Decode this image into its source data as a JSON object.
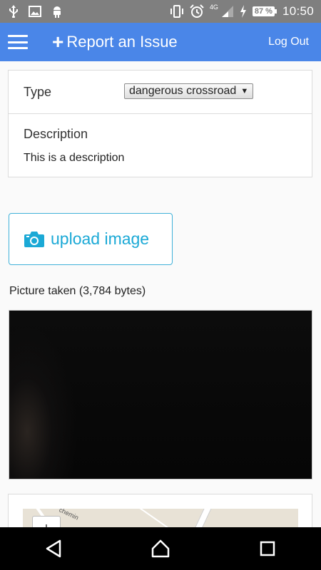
{
  "status_bar": {
    "time": "10:50",
    "battery_percent": "87 %",
    "network": "4G",
    "left_icons": [
      "usb-icon",
      "image-icon",
      "android-icon"
    ],
    "right_icons": [
      "vibrate-icon",
      "alarm-icon",
      "signal-icon",
      "charging-icon",
      "battery-icon"
    ]
  },
  "header": {
    "title": "Report an Issue",
    "logout_label": "Log Out"
  },
  "form": {
    "type_label": "Type",
    "type_value": "dangerous crossroad",
    "description_label": "Description",
    "description_value": "This is a description"
  },
  "upload": {
    "label": "upload image"
  },
  "picture": {
    "caption": "Picture taken (3,784 bytes)"
  },
  "map": {
    "zoom_in_label": "+",
    "street_label": "chemin"
  },
  "nav": {
    "buttons": [
      "back-icon",
      "home-icon",
      "recents-icon"
    ]
  },
  "colors": {
    "app_bar": "#4a86e8",
    "accent": "#1ba9d6",
    "status_bar": "#7f7f7f"
  }
}
